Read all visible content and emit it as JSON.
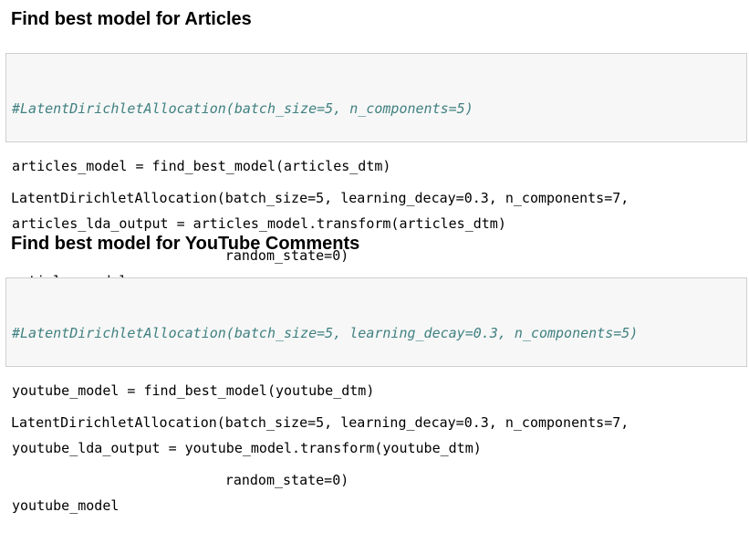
{
  "sections": [
    {
      "heading": "Find best model for Articles",
      "code": {
        "comment": "#LatentDirichletAllocation(batch_size=5, n_components=5)",
        "lines": [
          "articles_model = find_best_model(articles_dtm)",
          "articles_lda_output = articles_model.transform(articles_dtm)",
          "articles_model"
        ]
      },
      "output": [
        "LatentDirichletAllocation(batch_size=5, learning_decay=0.3, n_components=7,",
        "                          random_state=0)"
      ]
    },
    {
      "heading": "Find best model for YouTube Comments",
      "code": {
        "comment": "#LatentDirichletAllocation(batch_size=5, learning_decay=0.3, n_components=5)",
        "lines": [
          "youtube_model = find_best_model(youtube_dtm)",
          "youtube_lda_output = youtube_model.transform(youtube_dtm)",
          "youtube_model"
        ]
      },
      "output": [
        "LatentDirichletAllocation(batch_size=5, learning_decay=0.3, n_components=7,",
        "                          random_state=0)"
      ]
    }
  ],
  "colors": {
    "comment": "#408080",
    "cell_background": "#f7f7f7",
    "cell_border": "#cfcfcf"
  }
}
